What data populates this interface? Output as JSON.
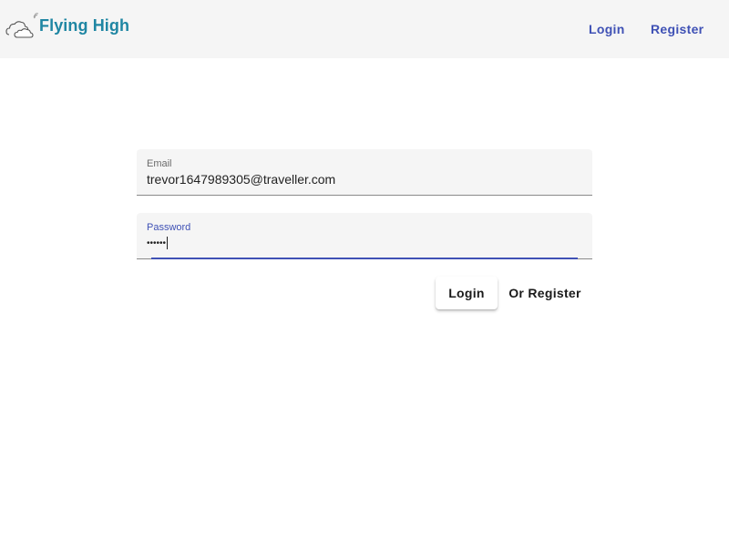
{
  "header": {
    "logo_text": "Flying High",
    "nav": {
      "login_label": "Login",
      "register_label": "Register"
    }
  },
  "form": {
    "email": {
      "label": "Email",
      "value": "trevor1647989305@traveller.com"
    },
    "password": {
      "label": "Password",
      "masked_value": "••••••"
    },
    "login_button_label": "Login",
    "register_button_label": "Or Register"
  },
  "colors": {
    "brand": "#1f86a3",
    "accent": "#3f51b5",
    "topbar_background": "#f5f5f5"
  },
  "icons": {
    "logo": "clouds-icon"
  }
}
